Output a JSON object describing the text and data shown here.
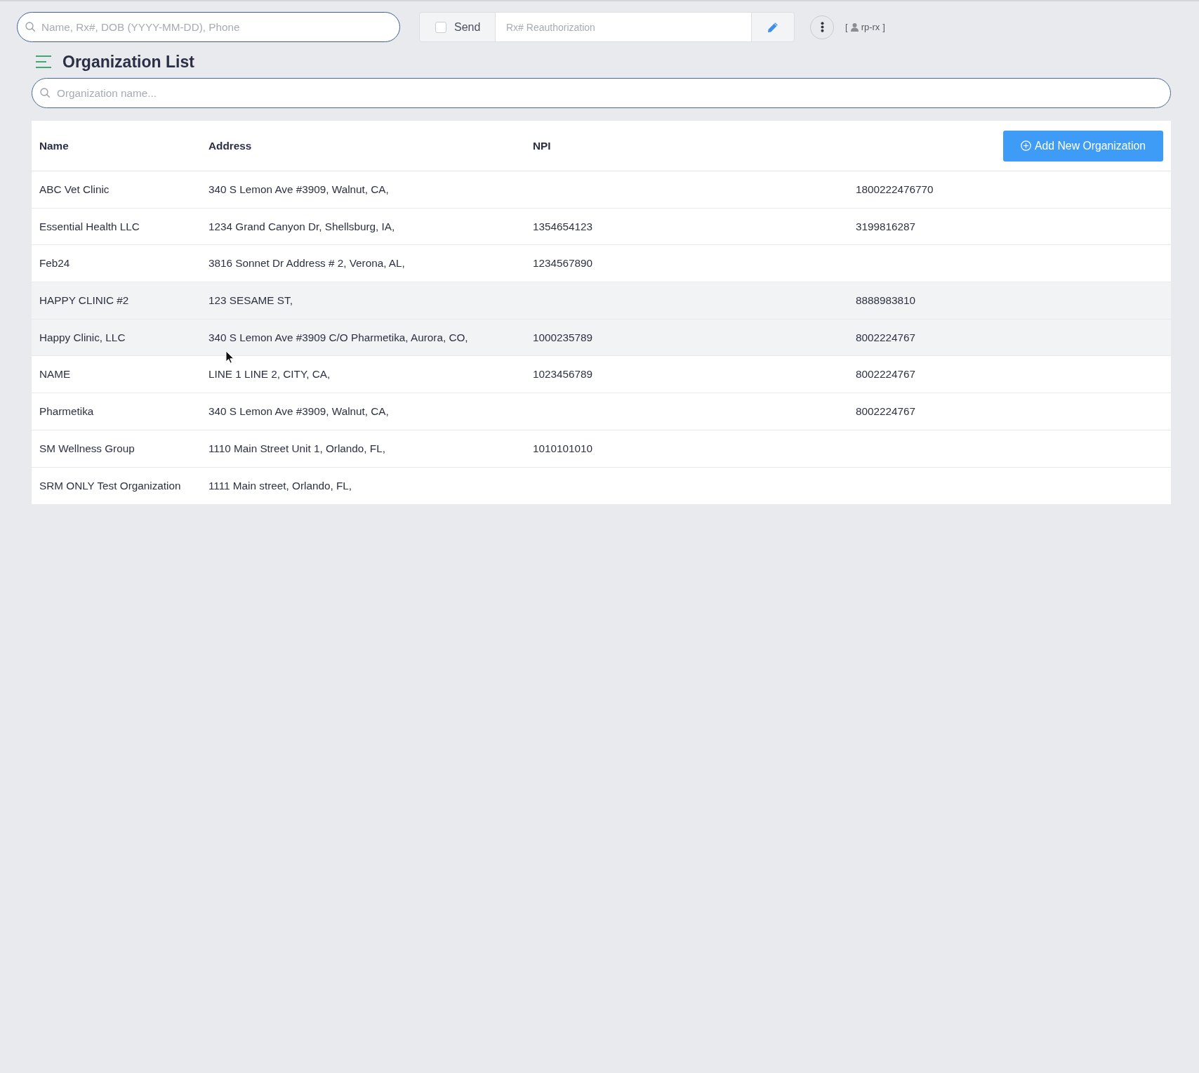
{
  "top_bar": {
    "search": {
      "placeholder": "Name, Rx#, DOB (YYYY-MM-DD), Phone"
    },
    "send": {
      "label": "Send",
      "checked": false
    },
    "reauthorization": {
      "placeholder": "Rx# Reauthorization"
    },
    "user": {
      "open_bracket": "[",
      "username": "rp-rx",
      "close_bracket": "]"
    }
  },
  "page": {
    "title": "Organization List",
    "search": {
      "placeholder": "Organization name..."
    }
  },
  "table": {
    "columns": [
      "Name",
      "Address",
      "NPI"
    ],
    "add_button": {
      "label": "Add New Organization"
    },
    "rows": [
      {
        "name": "ABC Vet Clinic",
        "address": "340 S Lemon Ave #3909, Walnut, CA,",
        "column_4": "1800222476770",
        "highlighted": false
      },
      {
        "name": "Essential Health LLC",
        "address": "1234 Grand Canyon Dr, Shellsburg, IA,",
        "npi": "1354654123",
        "column_4": "3199816287",
        "highlighted": false
      },
      {
        "name": "Feb24",
        "address": "3816 Sonnet Dr Address # 2, Verona, AL,",
        "npi": "1234567890",
        "highlighted": false
      },
      {
        "name": "HAPPY CLINIC #2",
        "address": "123 SESAME ST,",
        "column_4": "8888983810",
        "highlighted": true
      },
      {
        "name": "Happy Clinic, LLC",
        "address": "340 S Lemon Ave #3909 C/O Pharmetika, Aurora, CO,",
        "npi": "1000235789",
        "column_4": "8002224767",
        "highlighted": true
      },
      {
        "name": "NAME",
        "address": "LINE 1 LINE 2, CITY, CA,",
        "npi": "1023456789",
        "column_4": "8002224767",
        "highlighted": false
      },
      {
        "name": "Pharmetika",
        "address": "340 S Lemon Ave #3909, Walnut, CA,",
        "column_4": "8002224767",
        "highlighted": false
      },
      {
        "name": "SM Wellness Group",
        "address": "1110 Main Street Unit 1, Orlando, FL,",
        "npi": "1010101010",
        "highlighted": false
      },
      {
        "name": "SRM ONLY Test Organization",
        "address": "1111 Main street, Orlando, FL,",
        "highlighted": false
      }
    ]
  }
}
